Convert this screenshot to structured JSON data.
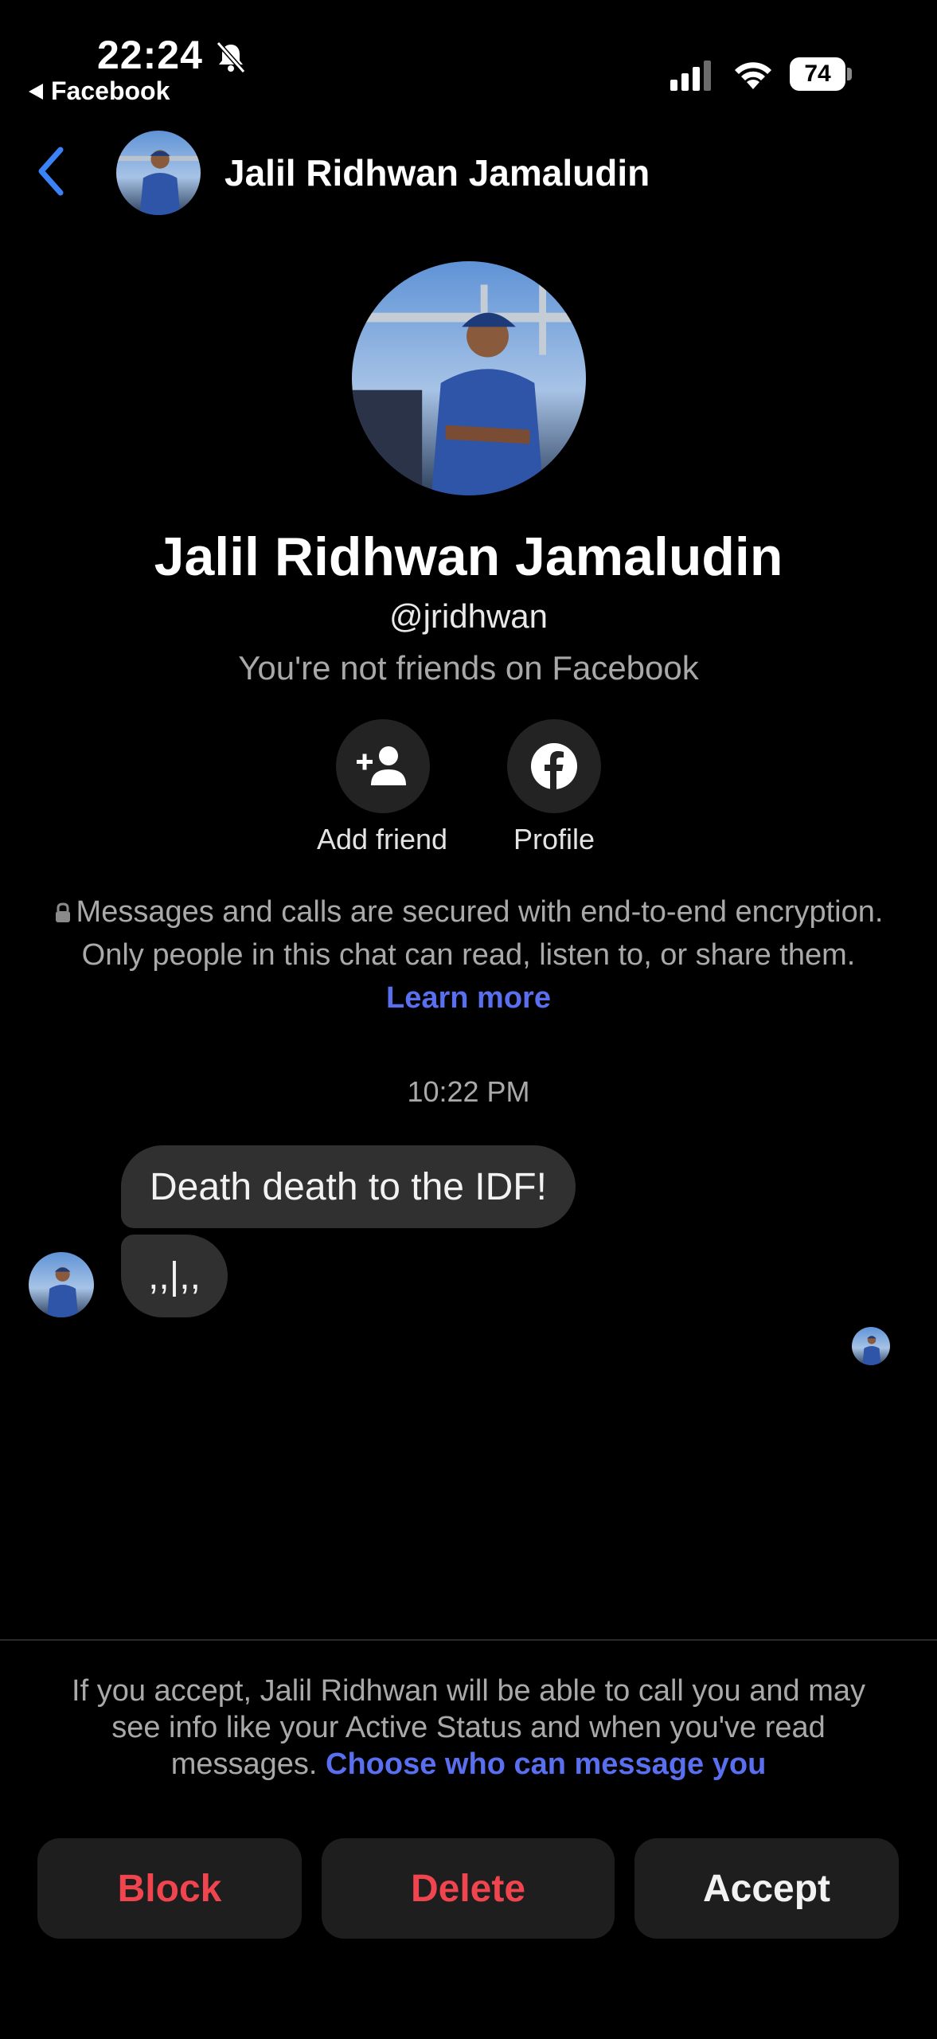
{
  "status_bar": {
    "time": "22:24",
    "back_app": "Facebook",
    "battery": "74"
  },
  "header": {
    "name": "Jalil Ridhwan Jamaludin"
  },
  "profile": {
    "name": "Jalil Ridhwan Jamaludin",
    "handle": "@jridhwan",
    "relation": "You're not friends on Facebook",
    "actions": {
      "add_friend": "Add friend",
      "profile": "Profile"
    }
  },
  "encryption": {
    "text": "Messages and calls are secured with end-to-end encryption. Only people in this chat can read, listen to, or share them.",
    "link": "Learn more"
  },
  "messages": {
    "timestamp": "10:22 PM",
    "items": [
      "Death death to the IDF!",
      ",,|,,"
    ]
  },
  "request": {
    "notice": "If you accept, Jalil Ridhwan will be able to call you and may see info like your Active Status and when you've read messages.",
    "link": "Choose who can message you",
    "buttons": {
      "block": "Block",
      "delete": "Delete",
      "accept": "Accept"
    }
  },
  "colors": {
    "accent": "#5a6ff0",
    "danger": "#f0444e",
    "back_chevron": "#3b82f6"
  }
}
